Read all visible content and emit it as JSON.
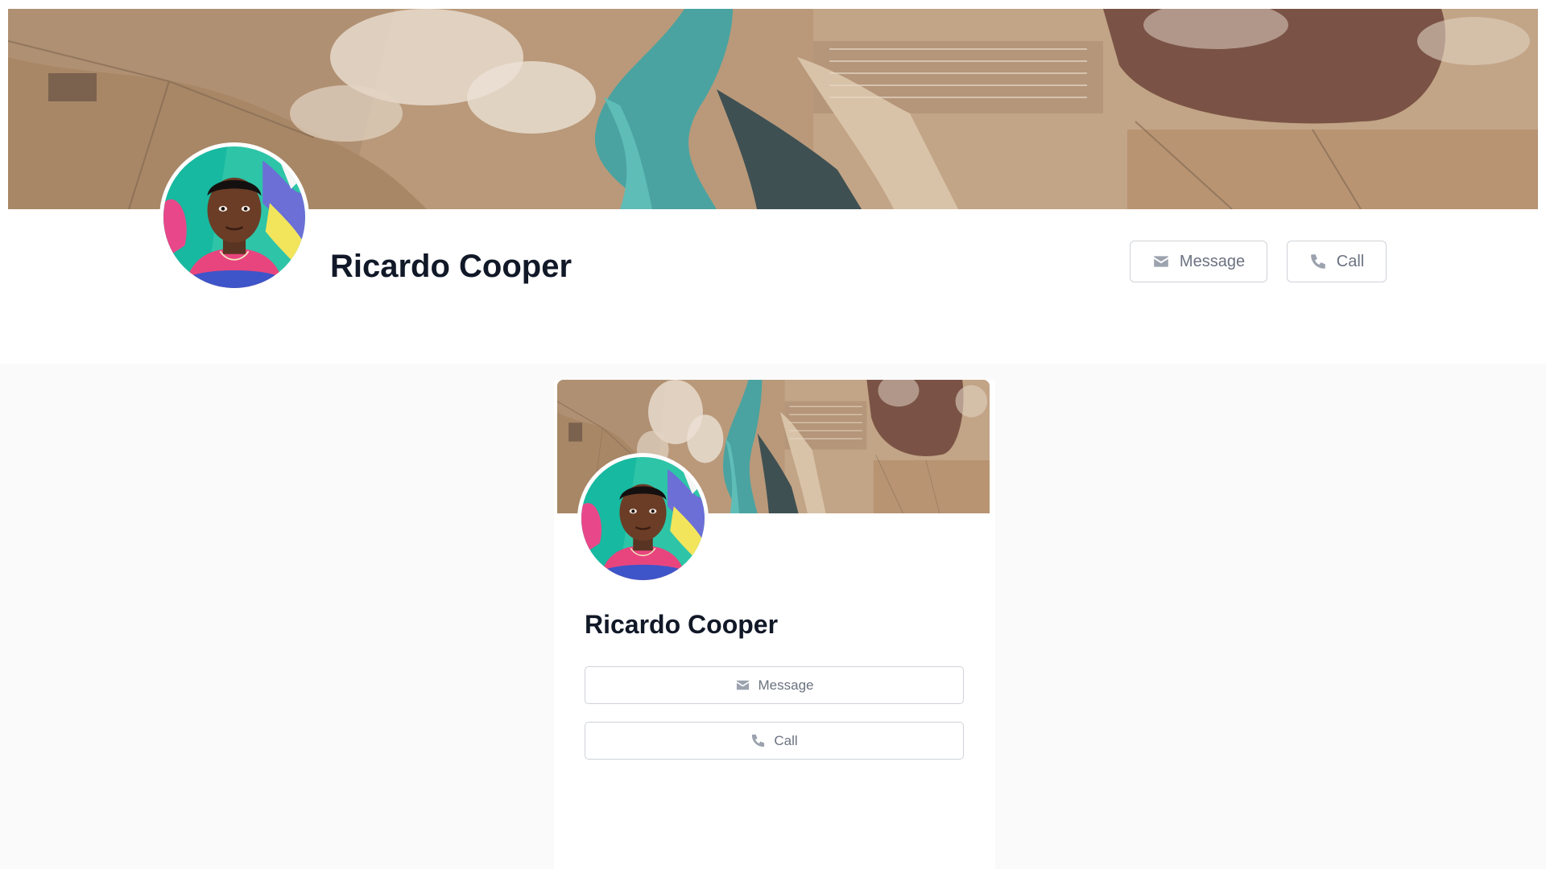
{
  "profile": {
    "name": "Ricardo Cooper",
    "message_label": "Message",
    "call_label": "Call"
  },
  "icons": {
    "message": "envelope-icon",
    "call": "phone-icon"
  },
  "colors": {
    "name_text": "#111827",
    "button_text": "#6b7280",
    "button_border": "#cfd3d8",
    "page_background": "#fafafa"
  }
}
